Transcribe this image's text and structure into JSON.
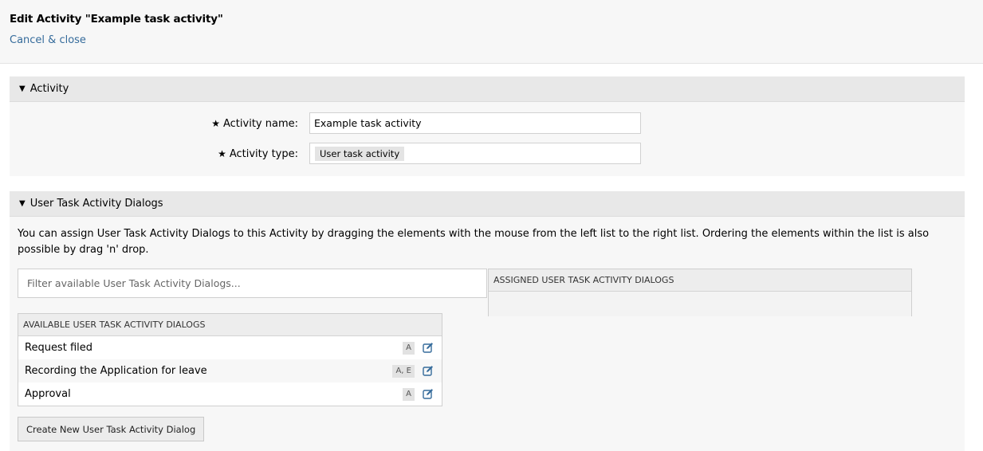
{
  "header": {
    "title": "Edit Activity \"Example task activity\"",
    "cancel_label": "Cancel & close"
  },
  "activity_section": {
    "heading": "Activity",
    "name_label": "Activity name:",
    "name_value": "Example task activity",
    "type_label": "Activity type:",
    "type_value": "User task activity",
    "required_marker": "★"
  },
  "dialogs_section": {
    "heading": "User Task Activity Dialogs",
    "description": "You can assign User Task Activity Dialogs to this Activity by dragging the elements with the mouse from the left list to the right list. Ordering the elements within the list is also possible by drag 'n' drop.",
    "filter_placeholder": "Filter available User Task Activity Dialogs...",
    "assigned_header": "ASSIGNED USER TASK ACTIVITY DIALOGS",
    "available_header": "AVAILABLE USER TASK ACTIVITY DIALOGS",
    "available_items": [
      {
        "label": "Request filed",
        "badge": "A"
      },
      {
        "label": "Recording the Application for leave",
        "badge": "A, E"
      },
      {
        "label": "Approval",
        "badge": "A"
      }
    ],
    "create_button": "Create New User Task Activity Dialog"
  },
  "icons": {
    "collapse": "caret-down-icon",
    "edit": "edit-icon"
  },
  "colors": {
    "link": "#356b9b",
    "edit_icon": "#356b9b"
  }
}
